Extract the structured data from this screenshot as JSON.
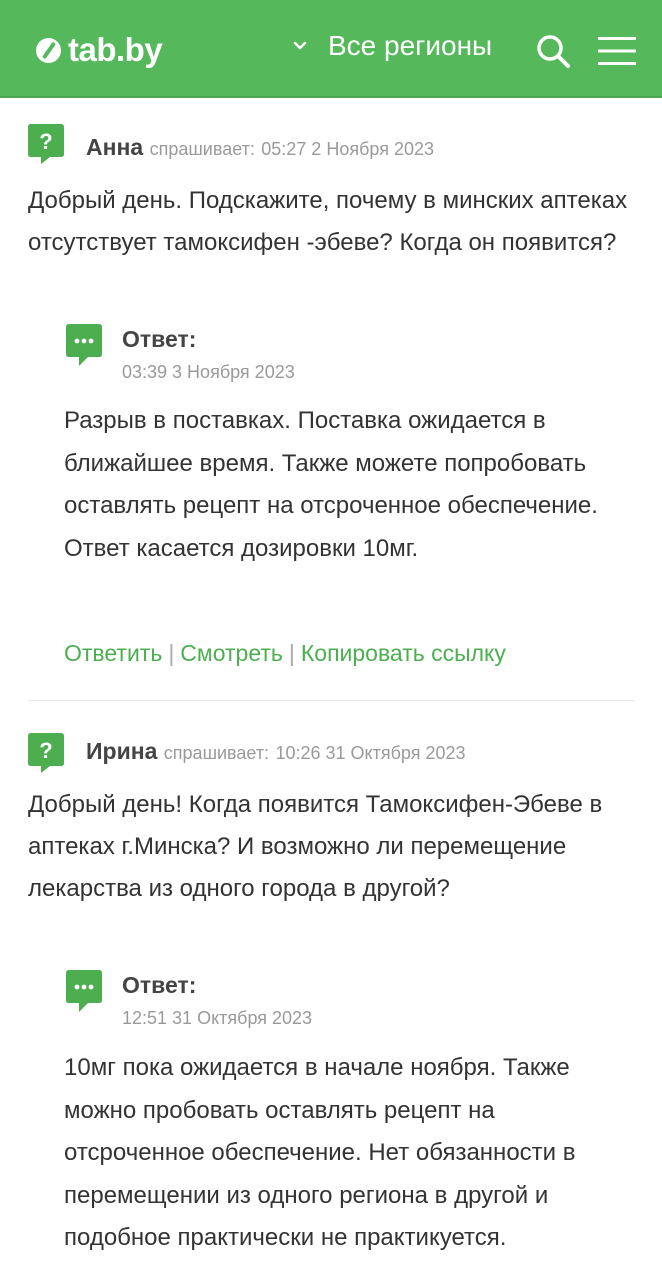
{
  "header": {
    "logo_text": "tab.by",
    "region_label": "Все регионы",
    "icons": [
      "logo-icon",
      "chevron-down-icon",
      "search-icon",
      "menu-icon"
    ],
    "accent_color": "#55b95c"
  },
  "questions": [
    {
      "author": "Анна",
      "asks_label": "спрашивает:",
      "datetime": "05:27 2 Ноября 2023",
      "text": "Добрый день. Подскажите, почему в минских аптеках отсутствует тамоксифен -эбеве? Когда он появится?",
      "answer": {
        "label": "Ответ:",
        "datetime": "03:39 3 Ноября 2023",
        "text": "Разрыв в поставках. Поставка ожидается в ближайшее время. Также можете попробовать оставлять рецепт на отсроченное обеспечение. Ответ касается дозировки 10мг."
      },
      "actions": {
        "reply": "Ответить",
        "view": "Смотреть",
        "copy_link": "Копировать ссылку",
        "separator": "|"
      }
    },
    {
      "author": "Ирина",
      "asks_label": "спрашивает:",
      "datetime": "10:26 31 Октября 2023",
      "text": "Добрый день! Когда появится Тамоксифен-Эбеве в аптеках г.Минска? И возможно ли перемещение лекарства из одного города в другой?",
      "answer": {
        "label": "Ответ:",
        "datetime": "12:51 31 Октября 2023",
        "text": "10мг пока ожидается в начале ноября. Также можно пробовать оставлять рецепт на отсроченное обеспечение. Нет обязанности в перемещении из одного региона в другой и подобное практически не практикуется."
      }
    }
  ]
}
